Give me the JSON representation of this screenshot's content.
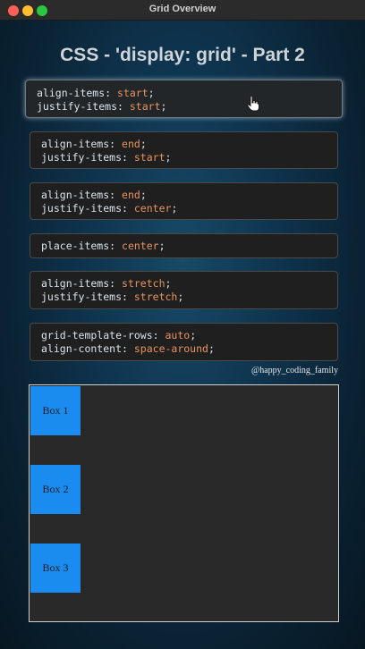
{
  "window": {
    "title": "Grid Overview"
  },
  "page": {
    "title": "CSS - 'display: grid' - Part 2"
  },
  "options": [
    {
      "lines": [
        {
          "prop": "align-items",
          "value": "start"
        },
        {
          "prop": "justify-items",
          "value": "start"
        }
      ],
      "active": true
    },
    {
      "lines": [
        {
          "prop": "align-items",
          "value": "end"
        },
        {
          "prop": "justify-items",
          "value": "start"
        }
      ]
    },
    {
      "lines": [
        {
          "prop": "align-items",
          "value": "end"
        },
        {
          "prop": "justify-items",
          "value": "center"
        }
      ]
    },
    {
      "lines": [
        {
          "prop": "place-items",
          "value": "center"
        }
      ]
    },
    {
      "lines": [
        {
          "prop": "align-items",
          "value": "stretch"
        },
        {
          "prop": "justify-items",
          "value": "stretch"
        }
      ]
    },
    {
      "lines": [
        {
          "prop": "grid-template-rows",
          "value": "auto"
        },
        {
          "prop": "align-content",
          "value": "space-around"
        }
      ]
    }
  ],
  "credit": "@happy_coding_family",
  "grid": {
    "boxes": [
      "Box 1",
      "Box 2",
      "Box 3"
    ]
  },
  "colors": {
    "box": "#1a8cf0",
    "code_value": "#e8935f",
    "code_property": "#d9e4ec"
  }
}
